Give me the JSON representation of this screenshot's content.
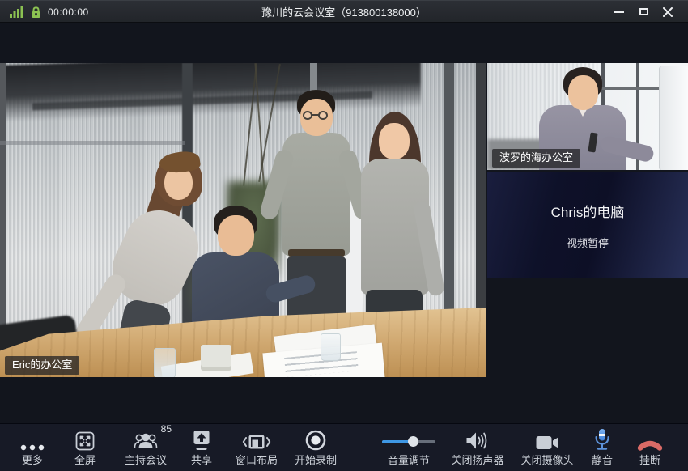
{
  "titlebar": {
    "timer": "00:00:00",
    "title": "豫川的云会议室（913800138000）",
    "icons": [
      "signal-bars-icon",
      "lock-icon"
    ],
    "controls": [
      "minimize",
      "maximize",
      "close"
    ]
  },
  "videos": {
    "main": {
      "label": "Eric的办公室"
    },
    "side": {
      "label": "波罗的海办公室"
    },
    "paused": {
      "title": "Chris的电脑",
      "subtitle": "视频暂停"
    }
  },
  "toolbar": {
    "items": [
      {
        "id": "more",
        "label": "更多",
        "icon": "more-dots-icon"
      },
      {
        "id": "fullscreen",
        "label": "全屏",
        "icon": "fullscreen-icon"
      },
      {
        "id": "host",
        "label": "主持会议",
        "icon": "participants-icon",
        "badge": "85"
      },
      {
        "id": "share",
        "label": "共享",
        "icon": "share-upload-icon"
      },
      {
        "id": "layout",
        "label": "窗口布局",
        "icon": "window-layout-icon"
      },
      {
        "id": "record",
        "label": "开始录制",
        "icon": "record-icon"
      },
      {
        "id": "volume",
        "label": "音量调节",
        "icon": "volume-slider",
        "volume_percent": 58
      },
      {
        "id": "speaker",
        "label": "关闭扬声器",
        "icon": "speaker-icon"
      },
      {
        "id": "camera",
        "label": "关闭摄像头",
        "icon": "camera-icon"
      },
      {
        "id": "mute",
        "label": "静音",
        "icon": "microphone-icon"
      },
      {
        "id": "hangup",
        "label": "挂断",
        "icon": "hangup-phone-icon"
      }
    ]
  },
  "colors": {
    "accent_green": "#8bc152",
    "accent_blue": "#3e97e4",
    "danger_red": "#d96a66",
    "titlebar_bg": "#25282e",
    "toolbar_bg": "#171a26",
    "window_bg": "#12151d"
  }
}
